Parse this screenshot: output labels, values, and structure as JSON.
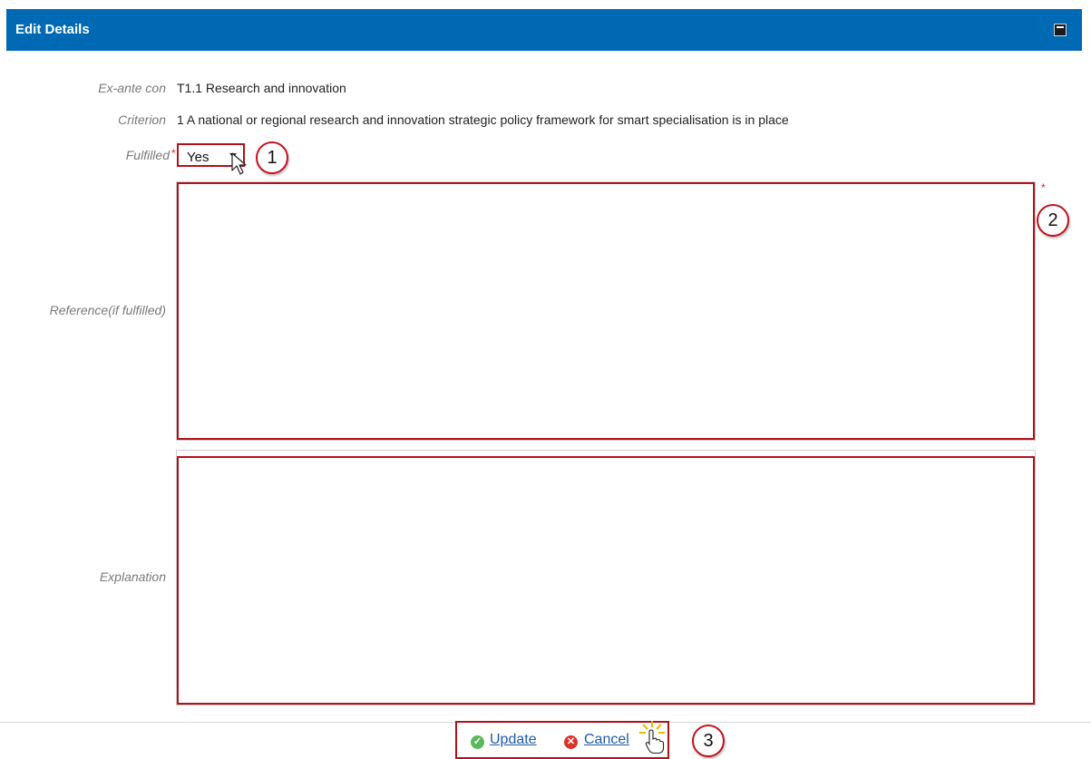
{
  "panel": {
    "title": "Edit Details",
    "maximize_icon": "maximize-icon"
  },
  "form": {
    "exante": {
      "label": "Ex-ante con",
      "value": "T1.1 Research and innovation"
    },
    "criterion": {
      "label": "Criterion",
      "value": "1 A national or regional research and innovation strategic policy framework for smart specialisation is in place"
    },
    "fulfilled": {
      "label": "Fulfilled",
      "required_mark": "*",
      "selected": "Yes"
    },
    "reference": {
      "label": "Reference(if fulfilled)",
      "required_mark": "*",
      "value": ""
    },
    "explanation": {
      "label": "Explanation",
      "value": ""
    }
  },
  "actions": {
    "update_label": "Update",
    "cancel_label": "Cancel",
    "update_icon": "check-circle-icon",
    "cancel_icon": "close-circle-icon"
  },
  "callouts": [
    "1",
    "2",
    "3"
  ],
  "colors": {
    "header": "#0069b4",
    "highlight": "#b0111a",
    "required": "#dd2222",
    "link": "#1e5aa8",
    "ok_green": "#5cb85c",
    "cancel_red": "#d9342b"
  }
}
